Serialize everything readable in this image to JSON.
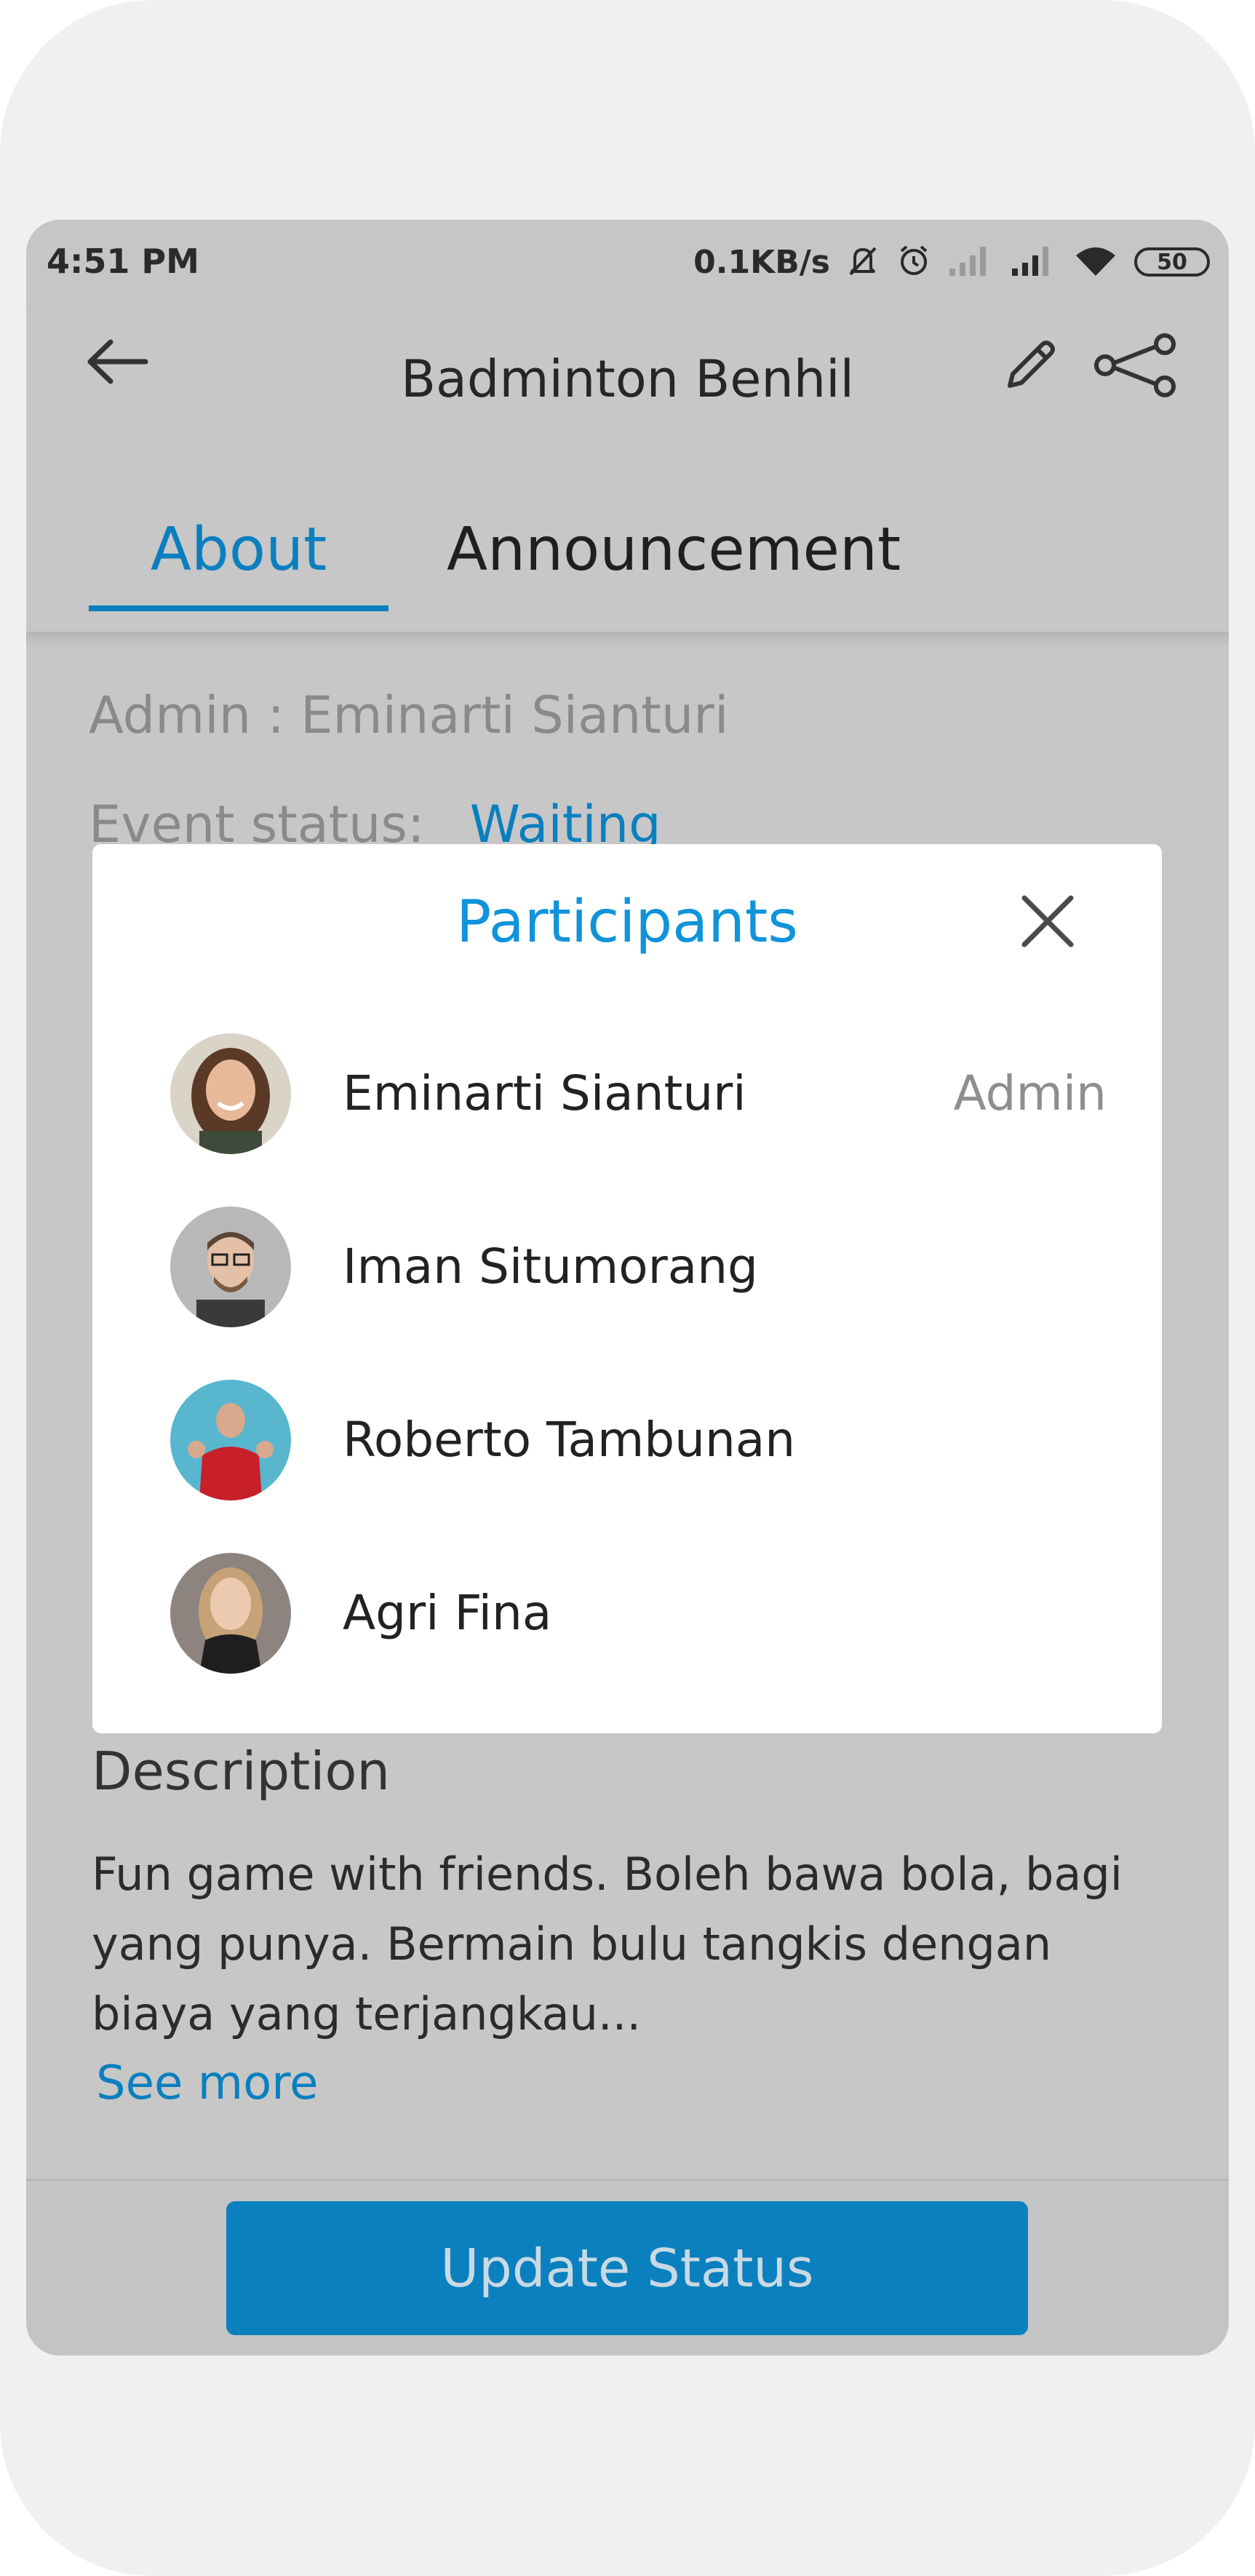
{
  "status_bar": {
    "time": "4:51 PM",
    "network_speed": "0.1KB/s",
    "battery": "50",
    "icons": [
      "mute-bell-icon",
      "alarm-icon",
      "signal-empty-icon",
      "signal-icon",
      "wifi-icon",
      "battery-icon"
    ]
  },
  "app_bar": {
    "title": "Badminton Benhil",
    "back_icon": "arrow-left-icon",
    "edit_icon": "pencil-icon",
    "share_icon": "share-icon"
  },
  "tabs": [
    {
      "label": "About",
      "active": true
    },
    {
      "label": "Announcement",
      "active": false
    }
  ],
  "about": {
    "admin_line": "Admin : Eminarti Sianturi",
    "status_label": "Event status:",
    "status_value": "Waiting"
  },
  "description": {
    "heading": "Description",
    "text": "Fun game with friends. Boleh bawa bola, bagi yang punya. Bermain bulu tangkis dengan biaya yang terjangkau...",
    "see_more": "See more"
  },
  "bottom": {
    "update_status_label": "Update Status"
  },
  "participants_modal": {
    "title": "Participants",
    "close_icon": "close-icon",
    "participants": [
      {
        "name": "Eminarti Sianturi",
        "role": "Admin"
      },
      {
        "name": "Iman Situmorang",
        "role": ""
      },
      {
        "name": "Roberto Tambunan",
        "role": ""
      },
      {
        "name": "Agri Fina",
        "role": ""
      }
    ]
  },
  "colors": {
    "accent": "#0F93DB",
    "primary_button": "#0A80BF",
    "overlay_background": "#C7C7C7",
    "frame_background": "#F0F0F0"
  }
}
